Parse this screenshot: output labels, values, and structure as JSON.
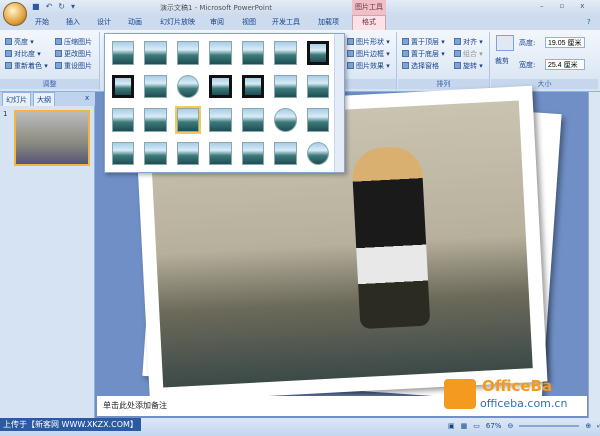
{
  "window": {
    "title": "演示文稿1 - Microsoft PowerPoint",
    "context_tab": "图片工具",
    "min": "–",
    "max": "▫",
    "close": "x"
  },
  "tabs": [
    "开始",
    "插入",
    "设计",
    "动画",
    "幻灯片放映",
    "审阅",
    "视图",
    "开发工具",
    "加载项",
    "格式"
  ],
  "ribbon": {
    "adjust": {
      "items": [
        "亮度",
        "对比度",
        "重新着色",
        "压缩图片",
        "更改图片",
        "重设图片"
      ],
      "caption": "调整"
    },
    "styles": {
      "items": [
        "图片形状",
        "图片边框",
        "图片效果"
      ]
    },
    "arrange": {
      "items": [
        "置于顶层",
        "置于底层",
        "选择窗格",
        "对齐",
        "组合",
        "旋转"
      ],
      "caption": "排列"
    },
    "size": {
      "crop": "裁剪",
      "height_label": "高度:",
      "height_value": "19.05 厘米",
      "width_label": "宽度:",
      "width_value": "25.4 厘米",
      "caption": "大小"
    }
  },
  "leftpane": {
    "tabs": [
      "幻灯片",
      "大纲"
    ],
    "slide_number": "1",
    "close": "x"
  },
  "notes": {
    "placeholder": "单击此处添加备注"
  },
  "status": {
    "upload": "上传于【新客网 WWW.XKZX.COM】",
    "zoom": "67%"
  },
  "logo": {
    "name": "OfficeBa",
    "url": "officeba.com.cn"
  }
}
